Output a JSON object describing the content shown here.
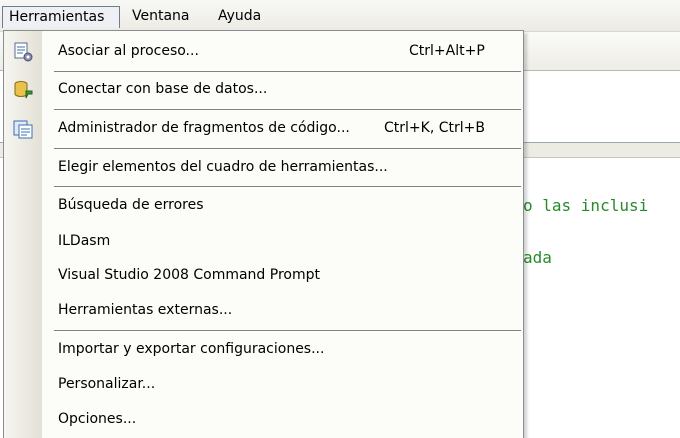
{
  "menubar": {
    "items": [
      {
        "label": "Herramientas",
        "active": true
      },
      {
        "label": "Ventana"
      },
      {
        "label": "Ayuda"
      }
    ]
  },
  "editor": {
    "code_fragments": [
      "o las inclusi",
      "ada"
    ]
  },
  "dropdown": {
    "items": [
      {
        "label": "Asociar al proceso...",
        "shortcut": "Ctrl+Alt+P",
        "icon": "attach-process-icon"
      },
      {
        "label": "Conectar con base de datos...",
        "icon": "connect-database-icon"
      },
      {
        "label": "Administrador de fragmentos de código...",
        "shortcut": "Ctrl+K, Ctrl+B",
        "icon": "snippet-manager-icon"
      },
      {
        "label": "Elegir elementos del cuadro de herramientas..."
      },
      {
        "label": "Búsqueda de errores"
      },
      {
        "label": "ILDasm"
      },
      {
        "label": "Visual Studio 2008 Command Prompt"
      },
      {
        "label": "Herramientas externas..."
      },
      {
        "label": "Importar y exportar configuraciones..."
      },
      {
        "label": "Personalizar..."
      },
      {
        "label": "Opciones..."
      }
    ]
  },
  "colors": {
    "code_comment": "#2a8a2a",
    "menu_border": "#8a8d92",
    "active_border": "#6b7c93"
  }
}
